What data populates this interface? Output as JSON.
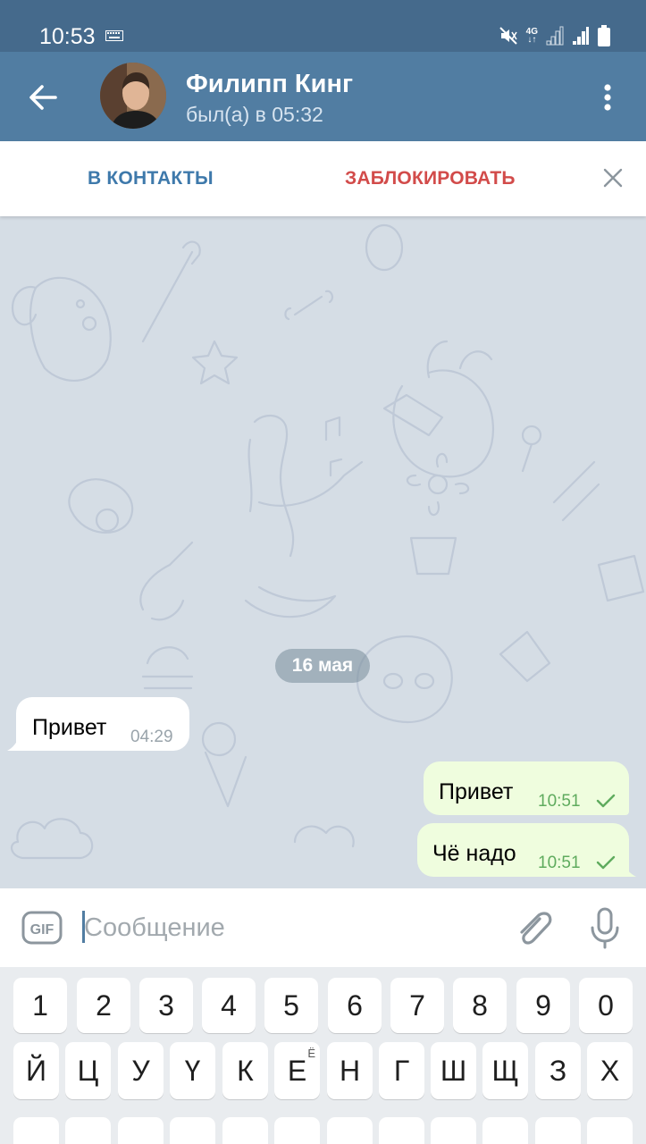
{
  "status_bar": {
    "time": "10:53",
    "network": "4G"
  },
  "header": {
    "back_icon": "arrow-left-icon",
    "name": "Филипп Кинг",
    "last_seen": "был(а) в 05:32",
    "menu_icon": "more-vertical-icon"
  },
  "action_bar": {
    "add_contact": "В КОНТАКТЫ",
    "block": "ЗАБЛОКИРОВАТЬ",
    "close_icon": "close-icon"
  },
  "chat": {
    "date": "16 мая",
    "messages": [
      {
        "text": "Привет",
        "time": "04:29",
        "direction": "incoming"
      },
      {
        "text": "Привет",
        "time": "10:51",
        "direction": "outgoing",
        "status": "read"
      },
      {
        "text": "Чё надо",
        "time": "10:51",
        "direction": "outgoing",
        "status": "read"
      }
    ]
  },
  "composer": {
    "gif_label": "GIF",
    "placeholder": "Сообщение",
    "attach_icon": "paperclip-icon",
    "mic_icon": "microphone-icon"
  },
  "keyboard": {
    "row1": [
      "1",
      "2",
      "3",
      "4",
      "5",
      "6",
      "7",
      "8",
      "9",
      "0"
    ],
    "row2": [
      "Й",
      "Ц",
      "У",
      "Ү",
      "К",
      "Е",
      "Н",
      "Г",
      "Ш",
      "Щ",
      "З",
      "Х"
    ],
    "row2_accent": "Ё"
  },
  "colors": {
    "header": "#517da2",
    "status_bar": "#456a8c",
    "chat_background": "#d5dde5",
    "outgoing_bubble": "#effdde",
    "incoming_bubble": "#ffffff",
    "add_contact_text": "#3e79ab",
    "block_text": "#d24b4a",
    "outgoing_time": "#5fab5e"
  }
}
